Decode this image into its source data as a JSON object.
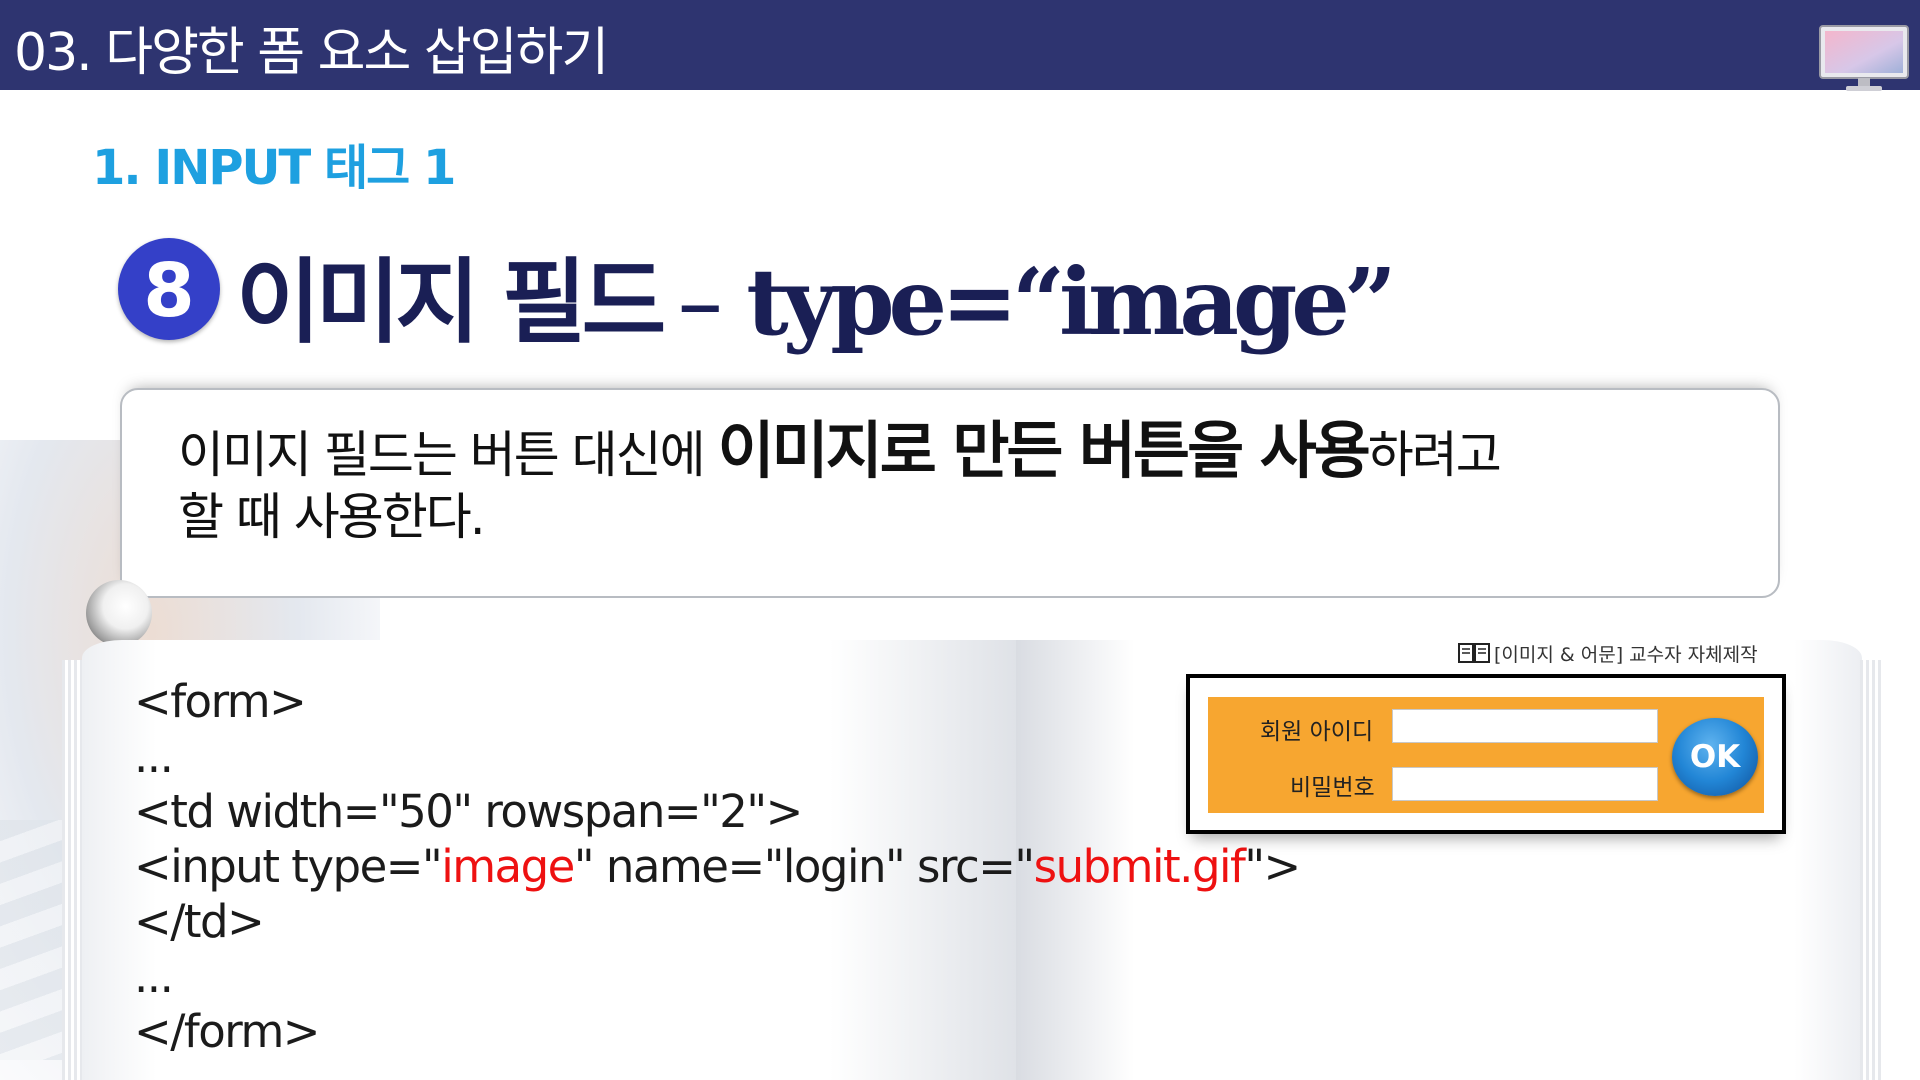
{
  "header": {
    "title": "03. 다양한 폼 요소 삽입하기"
  },
  "section": {
    "title": "1. INPUT 태그 1"
  },
  "heading": {
    "number": "8",
    "title": "이미지 필드",
    "dash": "–",
    "code": "type=“image”"
  },
  "description": {
    "part1": "이미지 필드는 버튼 대신에 ",
    "bold": "이미지로 만든 버튼을 사용",
    "part2": "하려고",
    "line2": "할 때 사용한다."
  },
  "code_example": {
    "line1": "<form>",
    "line2": "...",
    "line3": "<td width=\"50\" rowspan=\"2\">",
    "line4_a": "<input type=\"",
    "line4_red1": "image",
    "line4_b": "\" name=\"login\" src=\"",
    "line4_red2": "submit.gif",
    "line4_c": "\">",
    "line5": "</td>",
    "line6": "...",
    "line7": "</form>"
  },
  "credit": {
    "text": "[이미지 & 어문] 교수자 자체제작"
  },
  "login_demo": {
    "id_label": "회원 아이디",
    "pw_label": "비밀번호",
    "ok_label": "OK"
  },
  "colors": {
    "header_bg": "#2e3470",
    "section_title": "#1ea0e0",
    "heading_text": "#1a1f55",
    "circle_bg": "#3440c8",
    "highlight_red": "#ee1111",
    "login_panel": "#f7a630",
    "ok_button": "#2286d6"
  },
  "icons": [
    "monitor-icon",
    "book-icon"
  ]
}
